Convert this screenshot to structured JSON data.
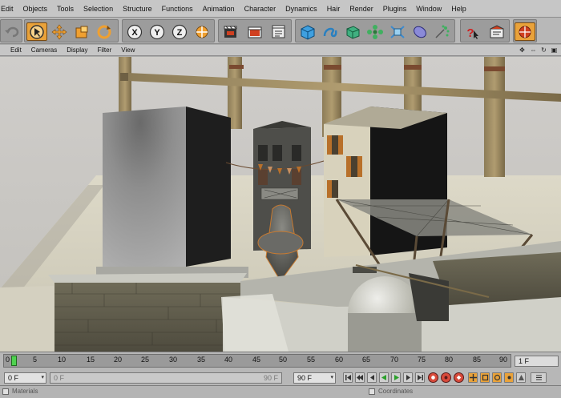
{
  "menubar": {
    "items": [
      "Edit",
      "Objects",
      "Tools",
      "Selection",
      "Structure",
      "Functions",
      "Animation",
      "Character",
      "Dynamics",
      "Hair",
      "Render",
      "Plugins",
      "Window",
      "Help"
    ]
  },
  "toolbar": {
    "groups": [
      {
        "name": "undo",
        "tools": [
          "undo-icon"
        ]
      },
      {
        "name": "modes",
        "tools": [
          "select-icon",
          "move-icon",
          "scale-icon",
          "rotate-icon"
        ]
      },
      {
        "name": "axes",
        "tools": [
          "x-axis-lock-icon",
          "y-axis-lock-icon",
          "z-axis-lock-icon",
          "world-coordinates-icon"
        ]
      },
      {
        "name": "render",
        "tools": [
          "render-view-icon",
          "render-picture-viewer-icon",
          "render-settings-icon"
        ]
      },
      {
        "name": "objects",
        "tools": [
          "cube-primitive-icon",
          "spline-icon",
          "nurbs-icon",
          "array-icon",
          "deformer-icon",
          "scene-object-icon",
          "particle-icon"
        ]
      },
      {
        "name": "help",
        "tools": [
          "help-icon",
          "tag-icon"
        ]
      },
      {
        "name": "layout",
        "tools": [
          "layout-icon"
        ]
      }
    ],
    "axis_labels": [
      "X",
      "Y",
      "Z"
    ]
  },
  "viewport_menu": {
    "items": [
      "Edit",
      "Cameras",
      "Display",
      "Filter",
      "View"
    ]
  },
  "timeline": {
    "ticks": [
      "0",
      "5",
      "10",
      "15",
      "20",
      "25",
      "30",
      "35",
      "40",
      "45",
      "50",
      "55",
      "60",
      "65",
      "70",
      "75",
      "80",
      "85",
      "90"
    ],
    "current_frame": 0,
    "end_frame_value": "1 F"
  },
  "transport": {
    "start_field": "0 F",
    "preview_start_field": "0 F",
    "preview_end_field": "90 F",
    "end_field": "90 F"
  },
  "statusbar": {
    "left_tab": "Materials",
    "right_tab": "Coordinates"
  },
  "colors": {
    "menubar_bg": "#c6c6c6",
    "toolbar_bg": "#b8b8b8",
    "viewport_floor": "#d9d6c9",
    "playhead": "#4fd24f",
    "record": "#d84a3a"
  }
}
